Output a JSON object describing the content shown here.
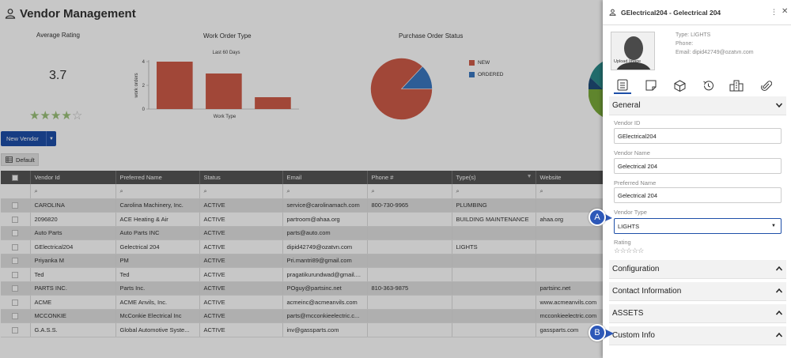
{
  "page": {
    "title": "Vendor Management"
  },
  "kpis": {
    "average_rating_label": "Average Rating",
    "average_rating_value": "3.7",
    "rating_stars": 4,
    "rating_max": 5,
    "work_order_type_label": "Work Order Type",
    "purchase_order_status_label": "Purchase Order Status"
  },
  "chart_data": [
    {
      "type": "bar",
      "title": "Work Order Type",
      "subtitle": "Last 60 Days",
      "xlabel": "Work Type",
      "ylabel": "work orders",
      "categories": [
        "",
        "",
        ""
      ],
      "values": [
        4,
        3,
        1
      ],
      "ylim": [
        0,
        4
      ],
      "yticks": [
        "0",
        "1",
        "2",
        "3",
        "4"
      ],
      "color": "#cf5b48"
    },
    {
      "type": "pie",
      "title": "Purchase Order Status",
      "labels": [
        "NEW",
        "ORDERED"
      ],
      "values": [
        87,
        13
      ],
      "colors": [
        "#cf5b48",
        "#3a78c0"
      ],
      "legend": "right"
    }
  ],
  "toolbar": {
    "new_vendor_label": "New Vendor",
    "view_label": "Default"
  },
  "table": {
    "columns": [
      "Vendor Id",
      "Preferred Name",
      "Status",
      "Email",
      "Phone #",
      "Type(s)",
      "Website"
    ],
    "rows": [
      [
        "CAROLINA",
        "Carolina Machinery, Inc.",
        "ACTIVE",
        "service@carolinamach.com",
        "800-730-9965",
        "PLUMBING",
        ""
      ],
      [
        "2096820",
        "ACE Heating & Air",
        "ACTIVE",
        "partroom@ahaa.org",
        "",
        "BUILDING MAINTENANCE",
        "ahaa.org"
      ],
      [
        "Auto Parts",
        "Auto Parts INC",
        "ACTIVE",
        "parts@auto.com",
        "",
        "",
        ""
      ],
      [
        "GElectrical204",
        "Gelectrical 204",
        "ACTIVE",
        "dipid42749@ozatvn.com",
        "",
        "LIGHTS",
        ""
      ],
      [
        "Priyanka M",
        "PM",
        "ACTIVE",
        "Pri.mantri89@gmail.com",
        "",
        "",
        ""
      ],
      [
        "Ted",
        "Ted",
        "ACTIVE",
        "pragatikurundwad@gmail....",
        "",
        "",
        ""
      ],
      [
        "PARTS INC.",
        "Parts Inc.",
        "ACTIVE",
        "POguy@partsinc.net",
        "810-363-9875",
        "",
        "partsinc.net"
      ],
      [
        "ACME",
        "ACME Anvils, Inc.",
        "ACTIVE",
        "acmeinc@acmeanvils.com",
        "",
        "",
        "www.acmeanvils.com"
      ],
      [
        "MCCONKIE",
        "McConkie Electrical Inc",
        "ACTIVE",
        "parts@mcconkieelectric.c...",
        "",
        "",
        "mcconkieelectric.com"
      ],
      [
        "G.A.S.S.",
        "Global Automotive Syste...",
        "ACTIVE",
        "inv@gassparts.com",
        "",
        "",
        "gassparts.com"
      ]
    ]
  },
  "panel": {
    "title": "GElectrical204 - Gelectrical 204",
    "upload_image_label": "Upload Image",
    "type_line": "Type: LIGHTS",
    "phone_line": "Phone:",
    "email_line": "Email: dipid42749@ozatvn.com",
    "general_label": "General",
    "vendor_id_label": "Vendor ID",
    "vendor_id_value": "GElectrical204",
    "vendor_name_label": "Vendor Name",
    "vendor_name_value": "Gelectrical 204",
    "preferred_name_label": "Preferred Name",
    "preferred_name_value": "Gelectrical 204",
    "vendor_type_label": "Vendor Type",
    "vendor_type_value": "LIGHTS",
    "rating_label": "Rating",
    "rating_stars": "☆☆☆☆☆",
    "sections": [
      "Configuration",
      "Contact Information",
      "ASSETS",
      "Custom Info"
    ]
  },
  "callouts": {
    "a": "A",
    "b": "B"
  },
  "colors": {
    "accent": "#1e4fa8",
    "header_dark": "#555555",
    "bar": "#cf5b48",
    "pie_ordered": "#3a78c0",
    "star_filled": "#9cc27a"
  }
}
